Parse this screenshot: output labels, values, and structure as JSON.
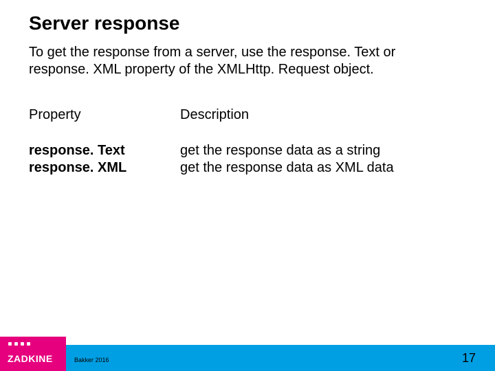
{
  "title": "Server response",
  "intro": "To get the response from a server, use the response. Text or response. XML property of the XMLHttp. Request object.",
  "table": {
    "header_property": "Property",
    "header_description": "Description",
    "prop1": "response. Text",
    "prop2": "response. XML",
    "desc1": "get the response data as a string",
    "desc2": "get the response data as XML data"
  },
  "footer": {
    "author": "Bakker 2016",
    "page": "17",
    "logo_text": "ZADKINE"
  }
}
